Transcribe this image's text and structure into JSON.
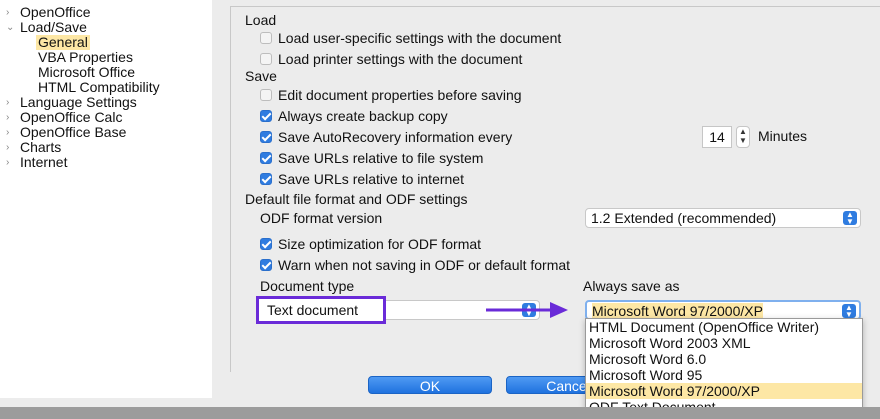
{
  "tree": {
    "items": [
      {
        "label": "OpenOffice",
        "level": 0
      },
      {
        "label": "Load/Save",
        "level": 0
      },
      {
        "label": "General",
        "level": 1
      },
      {
        "label": "VBA Properties",
        "level": 1
      },
      {
        "label": "Microsoft Office",
        "level": 1
      },
      {
        "label": "HTML Compatibility",
        "level": 1
      },
      {
        "label": "Language Settings",
        "level": 0
      },
      {
        "label": "OpenOffice Calc",
        "level": 0
      },
      {
        "label": "OpenOffice Base",
        "level": 0
      },
      {
        "label": "Charts",
        "level": 0
      },
      {
        "label": "Internet",
        "level": 0
      }
    ],
    "selected": "General"
  },
  "load": {
    "title": "Load",
    "user_settings": {
      "label": "Load user-specific settings with the document",
      "checked": false
    },
    "printer_settings": {
      "label": "Load printer settings with the document",
      "checked": false
    }
  },
  "save": {
    "title": "Save",
    "edit_props": {
      "label": "Edit document properties before saving",
      "checked": false
    },
    "backup": {
      "label": "Always create backup copy",
      "checked": true
    },
    "autorecovery": {
      "label": "Save AutoRecovery information every",
      "checked": true,
      "value": "14",
      "unit": "Minutes"
    },
    "urls_fs": {
      "label": "Save URLs relative to file system",
      "checked": true
    },
    "urls_inet": {
      "label": "Save URLs relative to internet",
      "checked": true
    }
  },
  "default_format": {
    "title": "Default file format and ODF settings",
    "odf_version_label": "ODF format version",
    "odf_version_value": "1.2 Extended (recommended)",
    "size_opt": {
      "label": "Size optimization for ODF format",
      "checked": true
    },
    "warn": {
      "label": "Warn when not saving in ODF or default format",
      "checked": true
    },
    "doc_type_label": "Document type",
    "doc_type_value": "Text document",
    "always_save_label": "Always save as",
    "always_save_value": "Microsoft Word 97/2000/XP",
    "options": [
      "HTML Document (OpenOffice Writer)",
      "Microsoft Word 2003 XML",
      "Microsoft Word 6.0",
      "Microsoft Word 95",
      "Microsoft Word 97/2000/XP",
      "ODF Text Document"
    ],
    "selected_option": "Microsoft Word 97/2000/XP"
  },
  "buttons": {
    "ok": "OK",
    "cancel": "Cancel"
  },
  "colors": {
    "accent": "#2f7ce0",
    "highlight": "#fde7a5",
    "annotation": "#6a2bd8"
  }
}
